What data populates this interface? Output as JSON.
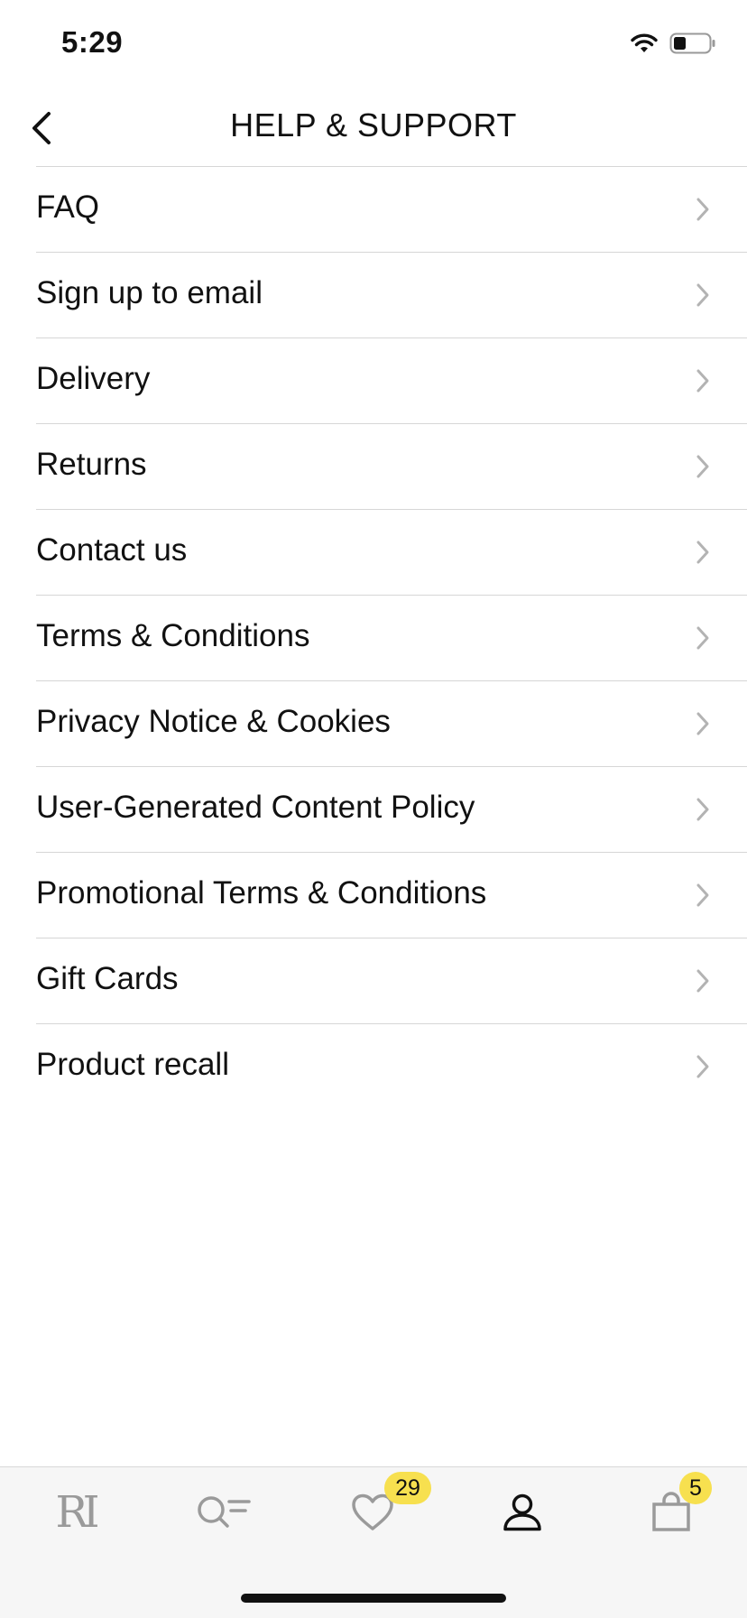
{
  "status_bar": {
    "time": "5:29"
  },
  "header": {
    "title": "HELP & SUPPORT"
  },
  "menu": {
    "items": [
      {
        "label": "FAQ"
      },
      {
        "label": "Sign up to email"
      },
      {
        "label": "Delivery"
      },
      {
        "label": "Returns"
      },
      {
        "label": "Contact us"
      },
      {
        "label": "Terms & Conditions"
      },
      {
        "label": "Privacy Notice & Cookies"
      },
      {
        "label": "User-Generated Content Policy"
      },
      {
        "label": "Promotional Terms & Conditions"
      },
      {
        "label": "Gift Cards"
      },
      {
        "label": "Product recall"
      }
    ]
  },
  "tab_bar": {
    "logo_text": "RI",
    "wishlist_badge": "29",
    "bag_badge": "5",
    "active_tab": "account"
  },
  "colors": {
    "badge": "#f7e04f",
    "divider": "#d6d6d6",
    "chevron": "#b3b3b3",
    "inactive_icon": "#9a9a9a",
    "active_icon": "#111111"
  },
  "icons": [
    "back-arrow-icon",
    "wifi-icon",
    "battery-icon",
    "chevron-right-icon",
    "search-filter-icon",
    "heart-icon",
    "user-icon",
    "shopping-bag-icon"
  ]
}
